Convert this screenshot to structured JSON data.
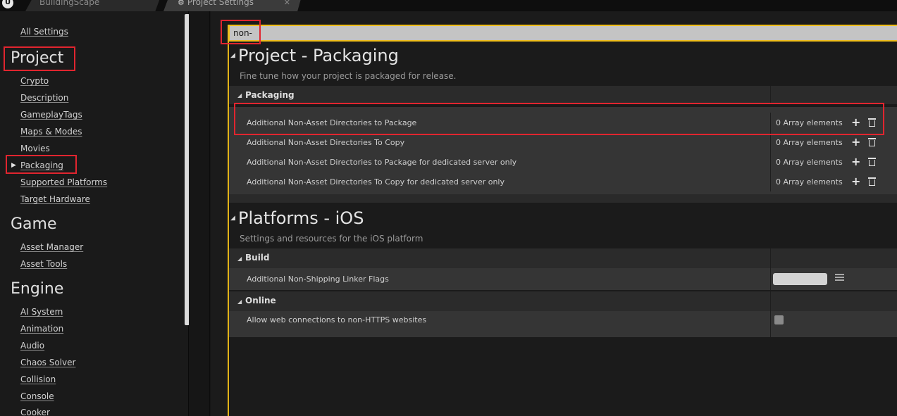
{
  "tabs": [
    {
      "label": "BuildingScape"
    },
    {
      "label": "Project Settings",
      "close": "✕"
    }
  ],
  "sidebar": {
    "all_settings": "All Settings",
    "groups": [
      {
        "title": "Project",
        "items": [
          "Crypto",
          "Description",
          "GameplayTags",
          "Maps & Modes",
          "Movies",
          "Packaging",
          "Supported Platforms",
          "Target Hardware"
        ]
      },
      {
        "title": "Game",
        "items": [
          "Asset Manager",
          "Asset Tools"
        ]
      },
      {
        "title": "Engine",
        "items": [
          "AI System",
          "Animation",
          "Audio",
          "Chaos Solver",
          "Collision",
          "Console",
          "Cooker"
        ]
      }
    ],
    "selected": "Packaging"
  },
  "search": {
    "value": "non-"
  },
  "sections": [
    {
      "title": "Project - Packaging",
      "description": "Fine tune how your project is packaged for release.",
      "category": "Packaging",
      "properties": [
        {
          "name": "Additional Non-Asset Directories to Package",
          "value": "0 Array elements"
        },
        {
          "name": "Additional Non-Asset Directories To Copy",
          "value": "0 Array elements"
        },
        {
          "name": "Additional Non-Asset Directories to Package for dedicated server only",
          "value": "0 Array elements"
        },
        {
          "name": "Additional Non-Asset Directories To Copy for dedicated server only",
          "value": "0 Array elements"
        }
      ]
    },
    {
      "title": "Platforms - iOS",
      "description": "Settings and resources for the iOS platform",
      "categories": [
        {
          "label": "Build",
          "properties": [
            {
              "name": "Additional Non-Shipping Linker Flags",
              "value": ""
            }
          ]
        },
        {
          "label": "Online",
          "properties": [
            {
              "name": "Allow web connections to non-HTTPS websites",
              "checked": false
            }
          ]
        }
      ]
    }
  ],
  "icons": {
    "plus": "+",
    "expand": "◢",
    "collapse": "▶"
  },
  "colors": {
    "accent": "#efbe1b",
    "highlight": "#e1252f"
  }
}
